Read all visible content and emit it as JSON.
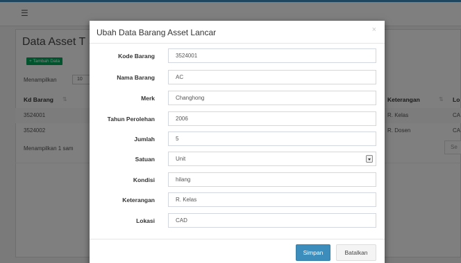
{
  "background": {
    "menu_icon": "hamburger-icon",
    "page_title": "Data Asset T",
    "add_button": "+ Tambah Data",
    "show_label": "Menampilkan",
    "show_value": "10",
    "table": {
      "headers": [
        "Kd Barang",
        "Keterangan",
        "Lo"
      ],
      "rows": [
        [
          "3524001",
          "R. Kelas",
          "CA"
        ],
        [
          "3524002",
          "R. Dosen",
          "CA"
        ]
      ]
    },
    "info_text": "Menampilkan 1 sam",
    "next_button": "Se"
  },
  "modal": {
    "title": "Ubah Data Barang Asset Lancar",
    "close_symbol": "×",
    "fields": [
      {
        "label": "Kode Barang",
        "value": "3524001"
      },
      {
        "label": "Nama Barang",
        "value": "AC"
      },
      {
        "label": "Merk",
        "value": "Changhong"
      },
      {
        "label": "Tahun Perolehan",
        "value": "2006"
      },
      {
        "label": "Jumlah",
        "value": "5"
      },
      {
        "label": "Satuan",
        "value": "Unit"
      },
      {
        "label": "Kondisi",
        "value": "hilang"
      },
      {
        "label": "Keterangan",
        "value": "R. Kelas"
      },
      {
        "label": "Lokasi",
        "value": "CAD"
      }
    ],
    "save_label": "Simpan",
    "cancel_label": "Batalkan"
  }
}
